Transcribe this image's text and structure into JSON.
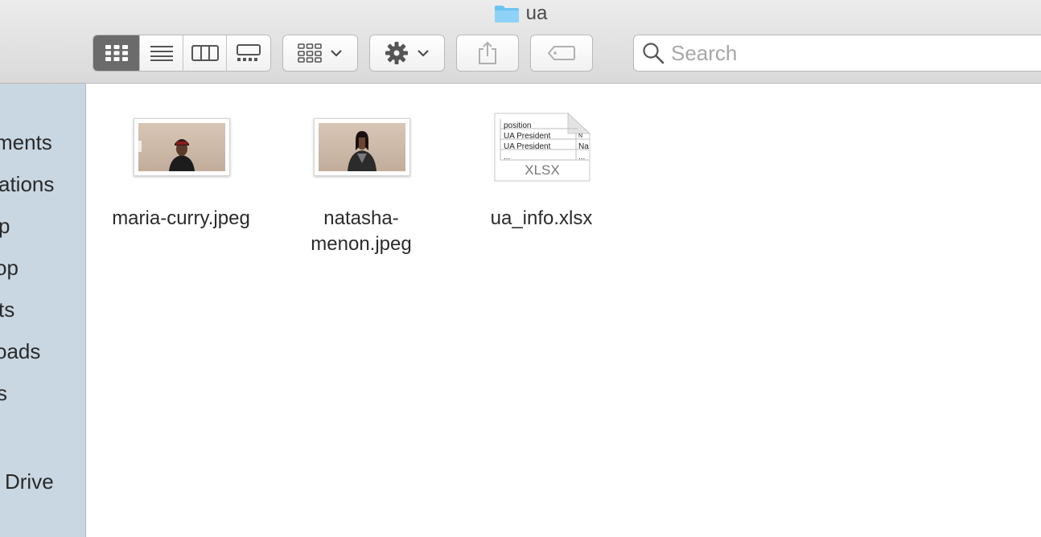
{
  "window": {
    "title": "ua"
  },
  "toolbar": {
    "view_buttons": [
      "icon-view",
      "list-view",
      "column-view",
      "gallery-view"
    ],
    "active_view": "icon-view",
    "search": {
      "placeholder": "Search",
      "value": ""
    }
  },
  "sidebar": {
    "items": [
      {
        "label": "ments"
      },
      {
        "label": "ations"
      },
      {
        "label": "p"
      },
      {
        "label": "op"
      },
      {
        "label": "ts"
      },
      {
        "label": "oads"
      },
      {
        "label": "s"
      },
      {
        "label": "Drive"
      }
    ]
  },
  "files": [
    {
      "name": "maria-curry.jpeg",
      "label_lines": [
        "maria-curry.jpeg"
      ],
      "type": "jpeg"
    },
    {
      "name": "natasha-menon.jpeg",
      "label_lines": [
        "natasha-",
        "menon.jpeg"
      ],
      "type": "jpeg"
    },
    {
      "name": "ua_info.xlsx",
      "label_lines": [
        "ua_info.xlsx"
      ],
      "type": "xlsx",
      "preview": {
        "rows": [
          "position",
          "UA President",
          "UA President",
          "..."
        ],
        "side": [
          "N",
          "Na",
          "..."
        ],
        "ext": "XLSX"
      }
    }
  ],
  "colors": {
    "sidebar_bg": "#c9d7e2",
    "folder_blue": "#6cc3f2",
    "active_segment": "#6b6b6b"
  }
}
